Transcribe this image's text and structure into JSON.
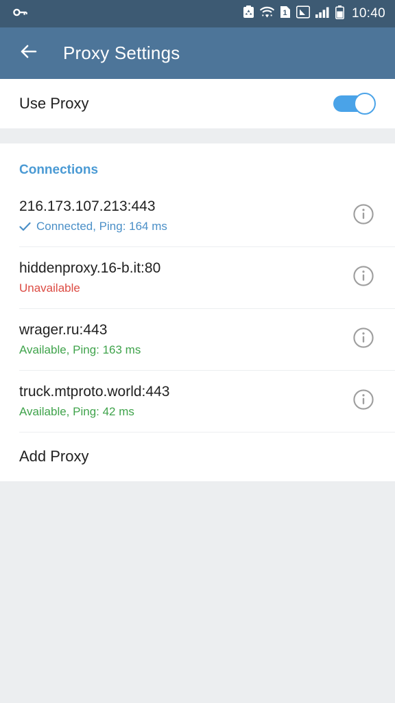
{
  "status_bar": {
    "left_icons": [
      {
        "name": "key-icon",
        "glyph": "key"
      }
    ],
    "right_icons": [
      {
        "name": "recycle-clipboard-icon"
      },
      {
        "name": "wifi-icon"
      },
      {
        "name": "sim-one-icon",
        "label": "1"
      },
      {
        "name": "signal-boxed-icon"
      },
      {
        "name": "signal-bars-icon"
      },
      {
        "name": "battery-icon"
      }
    ],
    "clock": "10:40"
  },
  "app_bar": {
    "back_label": "Back",
    "title": "Proxy Settings"
  },
  "use_proxy": {
    "label": "Use Proxy",
    "toggle_state": "on"
  },
  "connections": {
    "header": "Connections",
    "items": [
      {
        "address": "216.173.107.213:443",
        "status": "Connected, Ping: 164 ms",
        "status_color": "#4a8fc7",
        "has_check": true,
        "info_label": "Info"
      },
      {
        "address": "hiddenproxy.16-b.it:80",
        "status": "Unavailable",
        "status_color": "#dc4b43",
        "has_check": false,
        "info_label": "Info"
      },
      {
        "address": "wrager.ru:443",
        "status": "Available, Ping: 163 ms",
        "status_color": "#3fa34b",
        "has_check": false,
        "info_label": "Info"
      },
      {
        "address": "truck.mtproto.world:443",
        "status": "Available, Ping: 42 ms",
        "status_color": "#3fa34b",
        "has_check": false,
        "info_label": "Info"
      }
    ],
    "add_proxy_label": "Add Proxy"
  },
  "colors": {
    "status_bar_bg": "#3d5a73",
    "app_bar_bg": "#4d7599",
    "accent": "#4a9ad4",
    "toggle_on": "#4aa3e8",
    "page_bg": "#eceef0"
  }
}
